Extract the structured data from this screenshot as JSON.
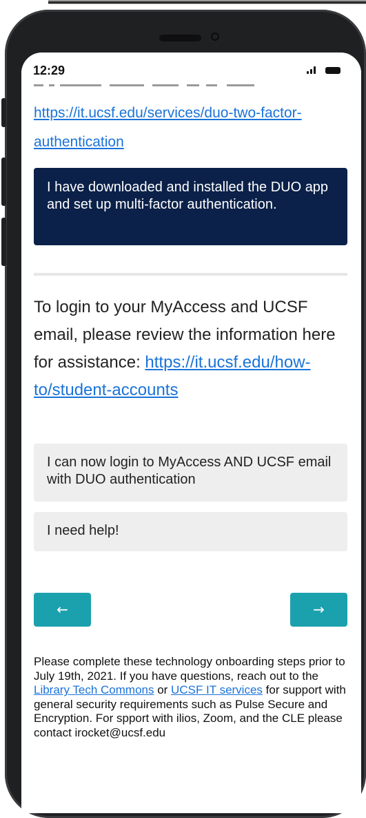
{
  "status_bar": {
    "time": "12:29"
  },
  "links": {
    "duo_url": "https://it.ucsf.edu/services/duo-two-factor-authentication"
  },
  "buttons": {
    "duo_installed": "I have downloaded and installed the DUO app and set up multi-factor authentication.",
    "can_login": "I can now login to MyAccess AND UCSF email with DUO authentication",
    "need_help": "I need help!",
    "back_arrow": "←",
    "next_arrow": "→"
  },
  "prompt": {
    "text": "To login to your MyAccess and UCSF email, please review the information here for assistance: ",
    "link": "https://it.ucsf.edu/how-to/student-accounts"
  },
  "footer": {
    "text_before": "Please complete these technology onboarding steps prior to July 19th, 2021. If you have questions, reach out to the ",
    "link_library": "Library Tech Commons",
    "text_or": " or ",
    "link_it": "UCSF IT services",
    "text_after": " for support with general security requirements such as Pulse Secure and Encryption. For spport with ilios, Zoom, and the CLE please contact irocket@ucsf.edu"
  },
  "colors": {
    "primary_button": "#0b2149",
    "nav_button": "#1aa1ad",
    "link": "#1a73d9",
    "option_button": "#eeeeee"
  },
  "icons": {
    "back": "arrow-left-icon",
    "next": "arrow-right-icon",
    "signal": "signal-icon",
    "battery": "battery-icon"
  }
}
